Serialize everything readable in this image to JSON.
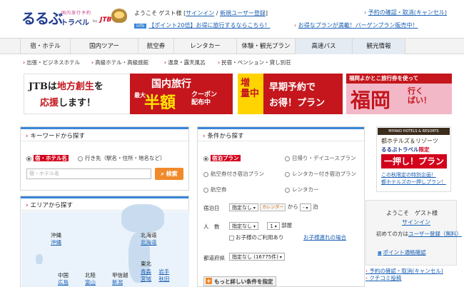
{
  "logo": {
    "main": "るるぶ",
    "sub": "国内旅行予約",
    "travel": "トラベル",
    "by": "by",
    "jtb": "JTB"
  },
  "header": {
    "welcome_prefix": "ようこそ ゲスト様 [",
    "signin": "サインイン",
    "sep": " / ",
    "register": "新規ユーザー登録",
    "welcome_suffix": "]",
    "reservation_link": "予約の確認・取消(キャンセル)",
    "info_badge": "info",
    "promo1": "【ポイント20倍】お得に旅行するならこちら！",
    "promo2": "お得なプランが満載！バーゲンプラン販売中！"
  },
  "nav": {
    "items": [
      "宿・ホテル",
      "国内ツアー",
      "航空券",
      "レンタカー",
      "体験・観光プラン",
      "高速バス",
      "観光情報"
    ]
  },
  "subnav": {
    "items": [
      "出張・ビジネスホテル",
      "高級ホテル・高級旅館",
      "温泉・露天風呂",
      "民宿・ペンション・貸し別荘"
    ]
  },
  "banners": {
    "b1": {
      "l1a": "JTBは",
      "l1b": "地方創生",
      "l1c": "を",
      "l2a": "応援",
      "l2b": "します！"
    },
    "b2": {
      "t1": "国内旅行",
      "t2": "最大",
      "t3": "半額",
      "t4a": "クーポン",
      "t4b": "配布中"
    },
    "b3": {
      "y1a": "増",
      "y1b": "量中",
      "y2": "ポイント",
      "t1": "早期予約で",
      "t2": "お得！プラン"
    },
    "b4": {
      "top": "福岡よかとこ旅行券を使って",
      "big": "福岡",
      "s1": "行く",
      "s2": "ばい！"
    }
  },
  "keyword": {
    "title": "キーワードから探す",
    "radio1": "宿・ホテル名",
    "radio2": "行き先（駅名・住所・地名など）",
    "placeholder": "宿・ホテル名",
    "button": "検索"
  },
  "area": {
    "title": "エリアから探す",
    "regions": [
      {
        "name": "沖縄",
        "sub": "沖縄"
      },
      {
        "name": "北海道",
        "sub": "北海道"
      },
      {
        "name": "東北",
        "sub": ""
      },
      {
        "name": "中国",
        "sub": "広島"
      },
      {
        "name": "北陸",
        "sub": "富山"
      },
      {
        "name": "甲信越",
        "sub": "新潟"
      }
    ],
    "tohoku_subs": [
      "青森",
      "岩手",
      "宮城",
      "秋田"
    ]
  },
  "conditions": {
    "title": "条件から探す",
    "plans": [
      {
        "label": "宿泊プラン",
        "selected": true
      },
      {
        "label": "日帰り・デイユースプラン",
        "selected": false
      },
      {
        "label": "航空券付き宿泊プラン",
        "selected": false
      },
      {
        "label": "レンタカー付き宿泊プラン",
        "selected": false
      },
      {
        "label": "航空券",
        "selected": false
      },
      {
        "label": "レンタカー",
        "selected": false
      }
    ],
    "checkin_label": "宿泊日",
    "checkin_value": "指定なし",
    "checkin_unit": "",
    "calendar": "カレンダー",
    "from": "から",
    "nights_value": "-",
    "nights_unit": "泊",
    "people_label": "人　数",
    "people_value": "指定なし",
    "rooms_value": "1",
    "rooms_unit": "部屋",
    "kids_check": "お子様のご利用あり",
    "kids_link": "お子様連れの場合",
    "pref_label": "都道府県",
    "pref_value": "指定なし (16775件)",
    "more_button": "もっと詳しい条件を指定"
  },
  "ad": {
    "top": "MIYAKO HOTELS & RESORTS",
    "t1": "都ホテルズ＆リゾーツ",
    "t2a": "るるぶトラベル",
    "t2b": "限定",
    "t3": "一押し！プラン",
    "t4a": "この秋限定の特別企画！",
    "t4b": "都ホテルズの一押しプラン！"
  },
  "login": {
    "greeting": "ようこそ　ゲスト様",
    "signin": "サインイン",
    "first_time": "初めての方は",
    "register_link": "ユーザー登録（無料）",
    "point_link": "ポイント通帳確認"
  },
  "bottom_links": [
    "予約の確認・取消(キャンセル)",
    "クチコミ投稿"
  ]
}
